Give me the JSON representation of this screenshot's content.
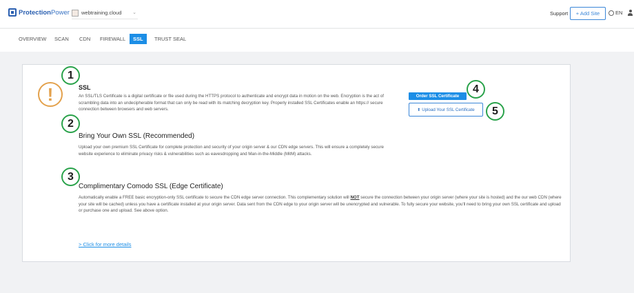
{
  "header": {
    "logo_bold": "Protection",
    "logo_light": "Power",
    "site": "webtraining.cloud",
    "support": "Support",
    "add_site": "+ Add Site",
    "lang": "EN"
  },
  "tabs": [
    {
      "label": "OVERVIEW",
      "active": false
    },
    {
      "label": "SCAN",
      "active": false
    },
    {
      "label": "CDN",
      "active": false
    },
    {
      "label": "FIREWALL",
      "active": false
    },
    {
      "label": "SSL",
      "active": true
    },
    {
      "label": "TRUST SEAL",
      "active": false
    }
  ],
  "callouts": [
    "1",
    "2",
    "3",
    "4",
    "5"
  ],
  "ssl": {
    "title": "SSL",
    "text": "An SSL/TLS Certificate is a digital certificate or file used during the HTTPS protocol to authenticate and encrypt data in motion on the web. Encryption is the act of scrambling data into an undecipherable format that can only be read with its matching decryption key. Properly installed SSL Certificates enable an https:// secure connection between browsers and web servers.",
    "order_button": "Order SSL Certificate",
    "upload_button": "Upload Your SSL Certificate"
  },
  "byo": {
    "title": "Bring Your Own SSL (Recommended)",
    "text": "Upload your own premium SSL Certificate for complete protection and security of your origin server & our CDN edge servers. This will ensure a completely secure website experience to eliminate privacy risks & vulnerabilities such as eavesdropping and Man-in-the-Middle (MitM) attacks."
  },
  "comodo": {
    "title": "Complimentary Comodo SSL (Edge Certificate)",
    "text_1": "Automatically enable a FREE basic encryption-only SSL certificate to secure the CDN edge server connection. This complementary solution will ",
    "text_not": "NOT",
    "text_2": " secure the connection between your origin server (where your site is hosted) and the our web CDN (where your site will be cached) unless you have a certificate installed at your origin server. Data sent from the CDN edge to your origin server will be unencrypted and vulnerable. To fully secure your website, you'll need to bring your own SSL certificate and upload or purchase one and upload. See above option."
  },
  "more_link": "> Click for more details",
  "colors": {
    "accent": "#1c8ee6",
    "callout_ring": "#29a24a",
    "warning": "#e3a14c"
  }
}
